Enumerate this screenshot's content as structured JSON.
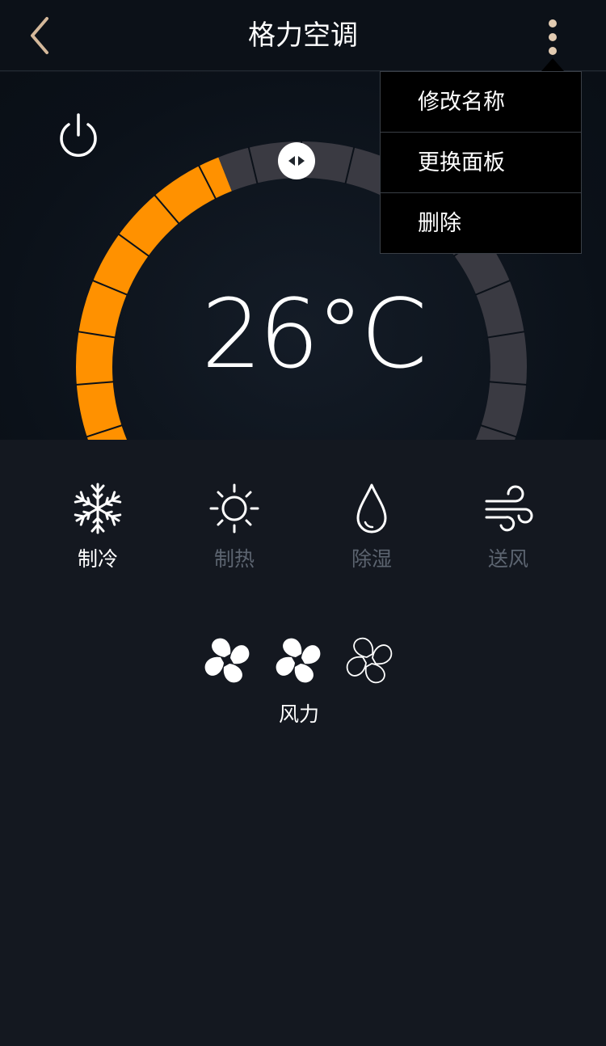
{
  "header": {
    "title": "格力空调",
    "back_icon": "chevron-left-icon",
    "more_icon": "more-vertical-icon"
  },
  "colors": {
    "accent": "#ff9100",
    "track": "#3a3a42",
    "inactive_text": "#5c6470",
    "back_icon": "#d4b89a"
  },
  "dial": {
    "temperature": "26°C",
    "level": 0.42,
    "power_icon": "power-icon",
    "handle_icon": "left-right-arrows-icon"
  },
  "menu": {
    "items": [
      {
        "label": "修改名称"
      },
      {
        "label": "更换面板"
      },
      {
        "label": "删除"
      }
    ]
  },
  "modes": [
    {
      "label": "制冷",
      "icon": "snowflake-icon",
      "active": true
    },
    {
      "label": "制热",
      "icon": "sun-icon",
      "active": false
    },
    {
      "label": "除湿",
      "icon": "droplet-icon",
      "active": false
    },
    {
      "label": "送风",
      "icon": "wind-icon",
      "active": false
    }
  ],
  "fan": {
    "label": "风力",
    "level": 2,
    "max_level": 3,
    "icon": "fan-icon"
  }
}
